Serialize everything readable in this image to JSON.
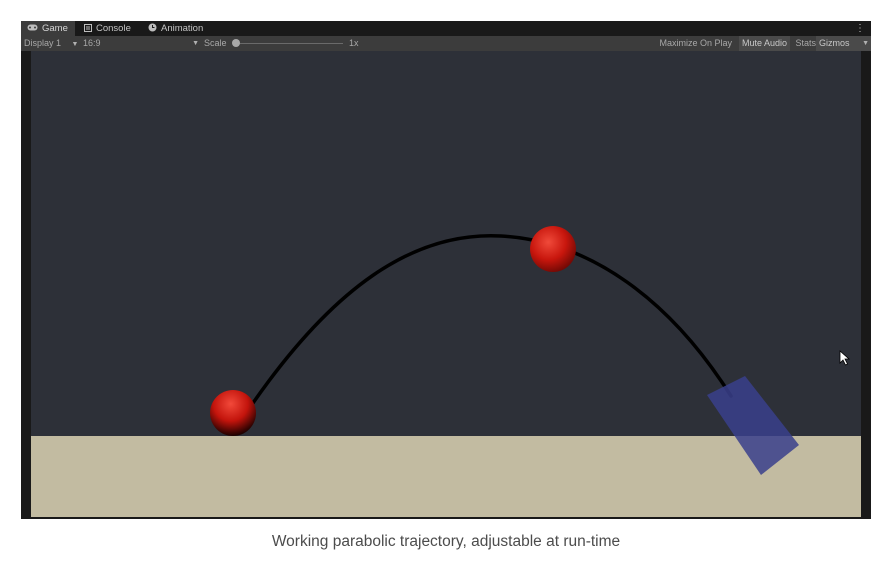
{
  "tabs": [
    {
      "label": "Game",
      "icon": "gamepad-icon",
      "active": true
    },
    {
      "label": "Console",
      "icon": "console-icon",
      "active": false
    },
    {
      "label": "Animation",
      "icon": "clock-icon",
      "active": false
    }
  ],
  "toolbar": {
    "display_value": "Display 1",
    "aspect_value": "16:9",
    "scale_label": "Scale",
    "scale_value": "1x",
    "maximize_label": "Maximize On Play",
    "mute_label": "Mute Audio",
    "stats_label": "Stats",
    "gizmos_label": "Gizmos"
  },
  "scene": {
    "background_color": "#2d3038",
    "ground_color": "#c2bba1",
    "trajectory_color": "#000000",
    "ball_color": "#d01a10",
    "target_color": "#3a3f8c"
  },
  "caption": "Working parabolic trajectory, adjustable at run-time"
}
